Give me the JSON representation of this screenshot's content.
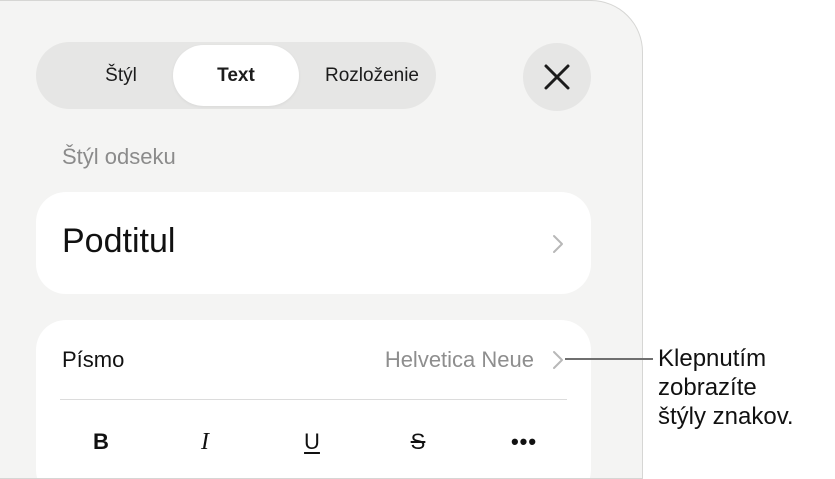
{
  "tabs": [
    {
      "label": "Štýl",
      "selected": false
    },
    {
      "label": "Text",
      "selected": true
    },
    {
      "label": "Rozloženie",
      "selected": false
    }
  ],
  "section": {
    "label": "Štýl odseku"
  },
  "paragraph_style": {
    "value": "Podtitul"
  },
  "font": {
    "label": "Písmo",
    "value": "Helvetica Neue"
  },
  "format_buttons": {
    "bold": "B",
    "italic": "I",
    "underline": "U",
    "strikethrough": "S",
    "more": "•••"
  },
  "callout": {
    "lines": [
      "Klepnutím",
      "zobrazíte",
      "štýly znakov."
    ]
  },
  "icons": {
    "close": "close-icon",
    "chevron": "chevron-right-icon"
  }
}
